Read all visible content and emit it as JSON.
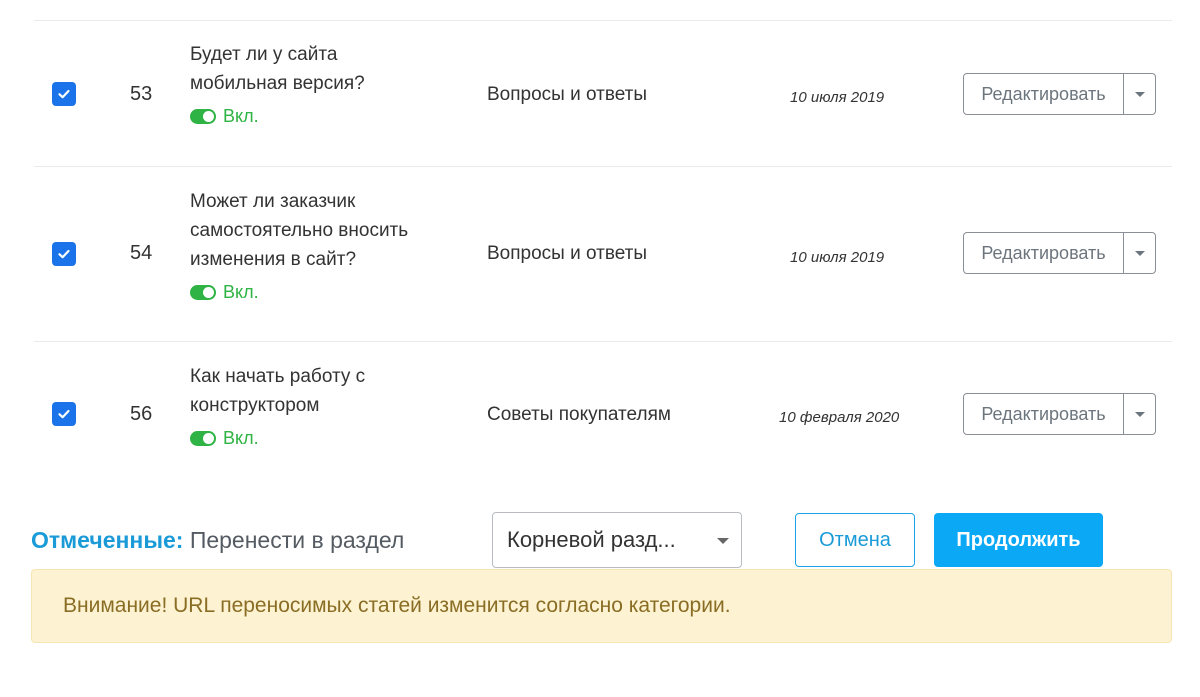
{
  "rows": [
    {
      "id": "53",
      "title_lines": [
        "Будет ли у сайта",
        "мобильная версия?"
      ],
      "status": "Вкл.",
      "category": "Вопросы и ответы",
      "date": "10 июля 2019",
      "edit_label": "Редактировать",
      "checked": true
    },
    {
      "id": "54",
      "title_lines": [
        "Может ли заказчик",
        "самостоятельно вносить",
        "изменения в сайт?"
      ],
      "status": "Вкл.",
      "category": "Вопросы и ответы",
      "date": "10 июля 2019",
      "edit_label": "Редактировать",
      "checked": true
    },
    {
      "id": "56",
      "title_lines": [
        "Как начать работу с",
        "конструктором"
      ],
      "status": "Вкл.",
      "category": "Советы покупателям",
      "date": "10 февраля 2020",
      "edit_label": "Редактировать",
      "checked": true
    }
  ],
  "bulk": {
    "label_strong": "Отмеченные:",
    "label_text": "Перенести в раздел",
    "select_value": "Корневой разд...",
    "cancel_label": "Отмена",
    "continue_label": "Продолжить"
  },
  "alert": {
    "text": "Внимание! URL переносимых статей изменится согласно категории."
  },
  "colors": {
    "accent": "#0ba8f5",
    "checkbox": "#1a73e8",
    "status_on": "#2fb344",
    "alert_bg": "#fdf3d2",
    "alert_text": "#8a6d24"
  },
  "icons": {
    "checkbox": "check-icon",
    "toggle": "toggle-on-icon",
    "dropdown": "chevron-down-icon"
  }
}
